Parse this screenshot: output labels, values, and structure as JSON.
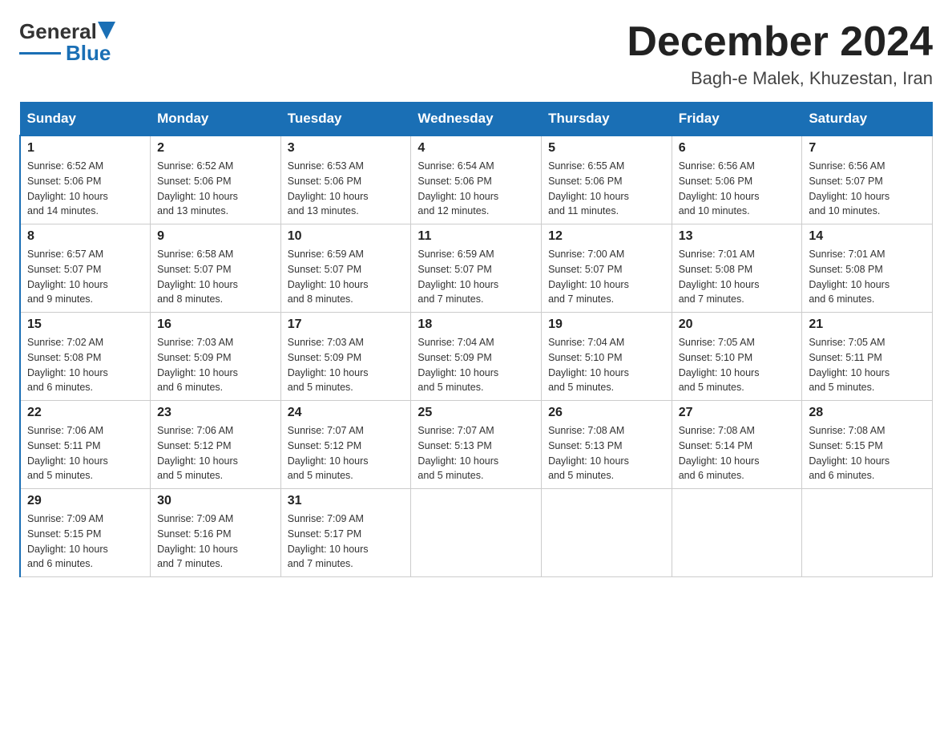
{
  "header": {
    "logo_general": "General",
    "logo_blue": "Blue",
    "title": "December 2024",
    "location": "Bagh-e Malek, Khuzestan, Iran"
  },
  "days_of_week": [
    "Sunday",
    "Monday",
    "Tuesday",
    "Wednesday",
    "Thursday",
    "Friday",
    "Saturday"
  ],
  "weeks": [
    [
      {
        "day": "1",
        "sunrise": "6:52 AM",
        "sunset": "5:06 PM",
        "daylight": "10 hours and 14 minutes."
      },
      {
        "day": "2",
        "sunrise": "6:52 AM",
        "sunset": "5:06 PM",
        "daylight": "10 hours and 13 minutes."
      },
      {
        "day": "3",
        "sunrise": "6:53 AM",
        "sunset": "5:06 PM",
        "daylight": "10 hours and 13 minutes."
      },
      {
        "day": "4",
        "sunrise": "6:54 AM",
        "sunset": "5:06 PM",
        "daylight": "10 hours and 12 minutes."
      },
      {
        "day": "5",
        "sunrise": "6:55 AM",
        "sunset": "5:06 PM",
        "daylight": "10 hours and 11 minutes."
      },
      {
        "day": "6",
        "sunrise": "6:56 AM",
        "sunset": "5:06 PM",
        "daylight": "10 hours and 10 minutes."
      },
      {
        "day": "7",
        "sunrise": "6:56 AM",
        "sunset": "5:07 PM",
        "daylight": "10 hours and 10 minutes."
      }
    ],
    [
      {
        "day": "8",
        "sunrise": "6:57 AM",
        "sunset": "5:07 PM",
        "daylight": "10 hours and 9 minutes."
      },
      {
        "day": "9",
        "sunrise": "6:58 AM",
        "sunset": "5:07 PM",
        "daylight": "10 hours and 8 minutes."
      },
      {
        "day": "10",
        "sunrise": "6:59 AM",
        "sunset": "5:07 PM",
        "daylight": "10 hours and 8 minutes."
      },
      {
        "day": "11",
        "sunrise": "6:59 AM",
        "sunset": "5:07 PM",
        "daylight": "10 hours and 7 minutes."
      },
      {
        "day": "12",
        "sunrise": "7:00 AM",
        "sunset": "5:07 PM",
        "daylight": "10 hours and 7 minutes."
      },
      {
        "day": "13",
        "sunrise": "7:01 AM",
        "sunset": "5:08 PM",
        "daylight": "10 hours and 7 minutes."
      },
      {
        "day": "14",
        "sunrise": "7:01 AM",
        "sunset": "5:08 PM",
        "daylight": "10 hours and 6 minutes."
      }
    ],
    [
      {
        "day": "15",
        "sunrise": "7:02 AM",
        "sunset": "5:08 PM",
        "daylight": "10 hours and 6 minutes."
      },
      {
        "day": "16",
        "sunrise": "7:03 AM",
        "sunset": "5:09 PM",
        "daylight": "10 hours and 6 minutes."
      },
      {
        "day": "17",
        "sunrise": "7:03 AM",
        "sunset": "5:09 PM",
        "daylight": "10 hours and 5 minutes."
      },
      {
        "day": "18",
        "sunrise": "7:04 AM",
        "sunset": "5:09 PM",
        "daylight": "10 hours and 5 minutes."
      },
      {
        "day": "19",
        "sunrise": "7:04 AM",
        "sunset": "5:10 PM",
        "daylight": "10 hours and 5 minutes."
      },
      {
        "day": "20",
        "sunrise": "7:05 AM",
        "sunset": "5:10 PM",
        "daylight": "10 hours and 5 minutes."
      },
      {
        "day": "21",
        "sunrise": "7:05 AM",
        "sunset": "5:11 PM",
        "daylight": "10 hours and 5 minutes."
      }
    ],
    [
      {
        "day": "22",
        "sunrise": "7:06 AM",
        "sunset": "5:11 PM",
        "daylight": "10 hours and 5 minutes."
      },
      {
        "day": "23",
        "sunrise": "7:06 AM",
        "sunset": "5:12 PM",
        "daylight": "10 hours and 5 minutes."
      },
      {
        "day": "24",
        "sunrise": "7:07 AM",
        "sunset": "5:12 PM",
        "daylight": "10 hours and 5 minutes."
      },
      {
        "day": "25",
        "sunrise": "7:07 AM",
        "sunset": "5:13 PM",
        "daylight": "10 hours and 5 minutes."
      },
      {
        "day": "26",
        "sunrise": "7:08 AM",
        "sunset": "5:13 PM",
        "daylight": "10 hours and 5 minutes."
      },
      {
        "day": "27",
        "sunrise": "7:08 AM",
        "sunset": "5:14 PM",
        "daylight": "10 hours and 6 minutes."
      },
      {
        "day": "28",
        "sunrise": "7:08 AM",
        "sunset": "5:15 PM",
        "daylight": "10 hours and 6 minutes."
      }
    ],
    [
      {
        "day": "29",
        "sunrise": "7:09 AM",
        "sunset": "5:15 PM",
        "daylight": "10 hours and 6 minutes."
      },
      {
        "day": "30",
        "sunrise": "7:09 AM",
        "sunset": "5:16 PM",
        "daylight": "10 hours and 7 minutes."
      },
      {
        "day": "31",
        "sunrise": "7:09 AM",
        "sunset": "5:17 PM",
        "daylight": "10 hours and 7 minutes."
      },
      null,
      null,
      null,
      null
    ]
  ],
  "labels": {
    "sunrise": "Sunrise:",
    "sunset": "Sunset:",
    "daylight": "Daylight:"
  }
}
